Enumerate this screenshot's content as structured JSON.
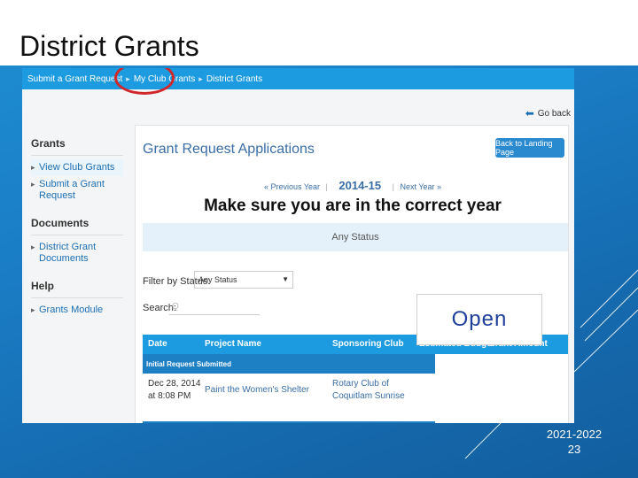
{
  "slide": {
    "title": "District Grants",
    "footer_year": "2021-2022",
    "footer_page": "23"
  },
  "topnav": {
    "items": [
      "Submit a Grant Request",
      "My Club Grants",
      "District Grants"
    ],
    "separator": "▸"
  },
  "go_back": "Go back",
  "sidebar": {
    "groups": [
      {
        "heading": "Grants",
        "links": [
          "View Club Grants",
          "Submit a Grant Request"
        ]
      },
      {
        "heading": "Documents",
        "links": [
          "District Grant Documents"
        ]
      },
      {
        "heading": "Help",
        "links": [
          "Grants Module"
        ]
      }
    ]
  },
  "panel": {
    "title": "Grant Request Applications",
    "landing_button": "Back to Landing Page",
    "prev_year": "« Previous Year",
    "current_year": "2014-15",
    "next_year": "Next Year »",
    "callout": "Make sure you are in the correct year",
    "status_bar": "Any Status",
    "filter_label": "Filter by Status:",
    "filter_value": "Any Status",
    "search_label": "Search:",
    "search_placeholder": "Q"
  },
  "table": {
    "columns": [
      "Date",
      "Project Name",
      "Sponsoring Club",
      "Estimated Budget",
      "Grant Amount"
    ],
    "group_label": "Initial Request Submitted",
    "rows": [
      {
        "date_line1": "Dec 28, 2014",
        "date_line2": "at 8:08 PM",
        "project": "Paint the Women's Shelter",
        "club_line1": "Rotary Club of",
        "club_line2": "Coquitlam Sunrise"
      }
    ]
  },
  "open_label": "Open",
  "colors": {
    "nav_blue": "#1d9be0",
    "circle_red": "#d0272a",
    "open_text": "#1e3f9a"
  }
}
